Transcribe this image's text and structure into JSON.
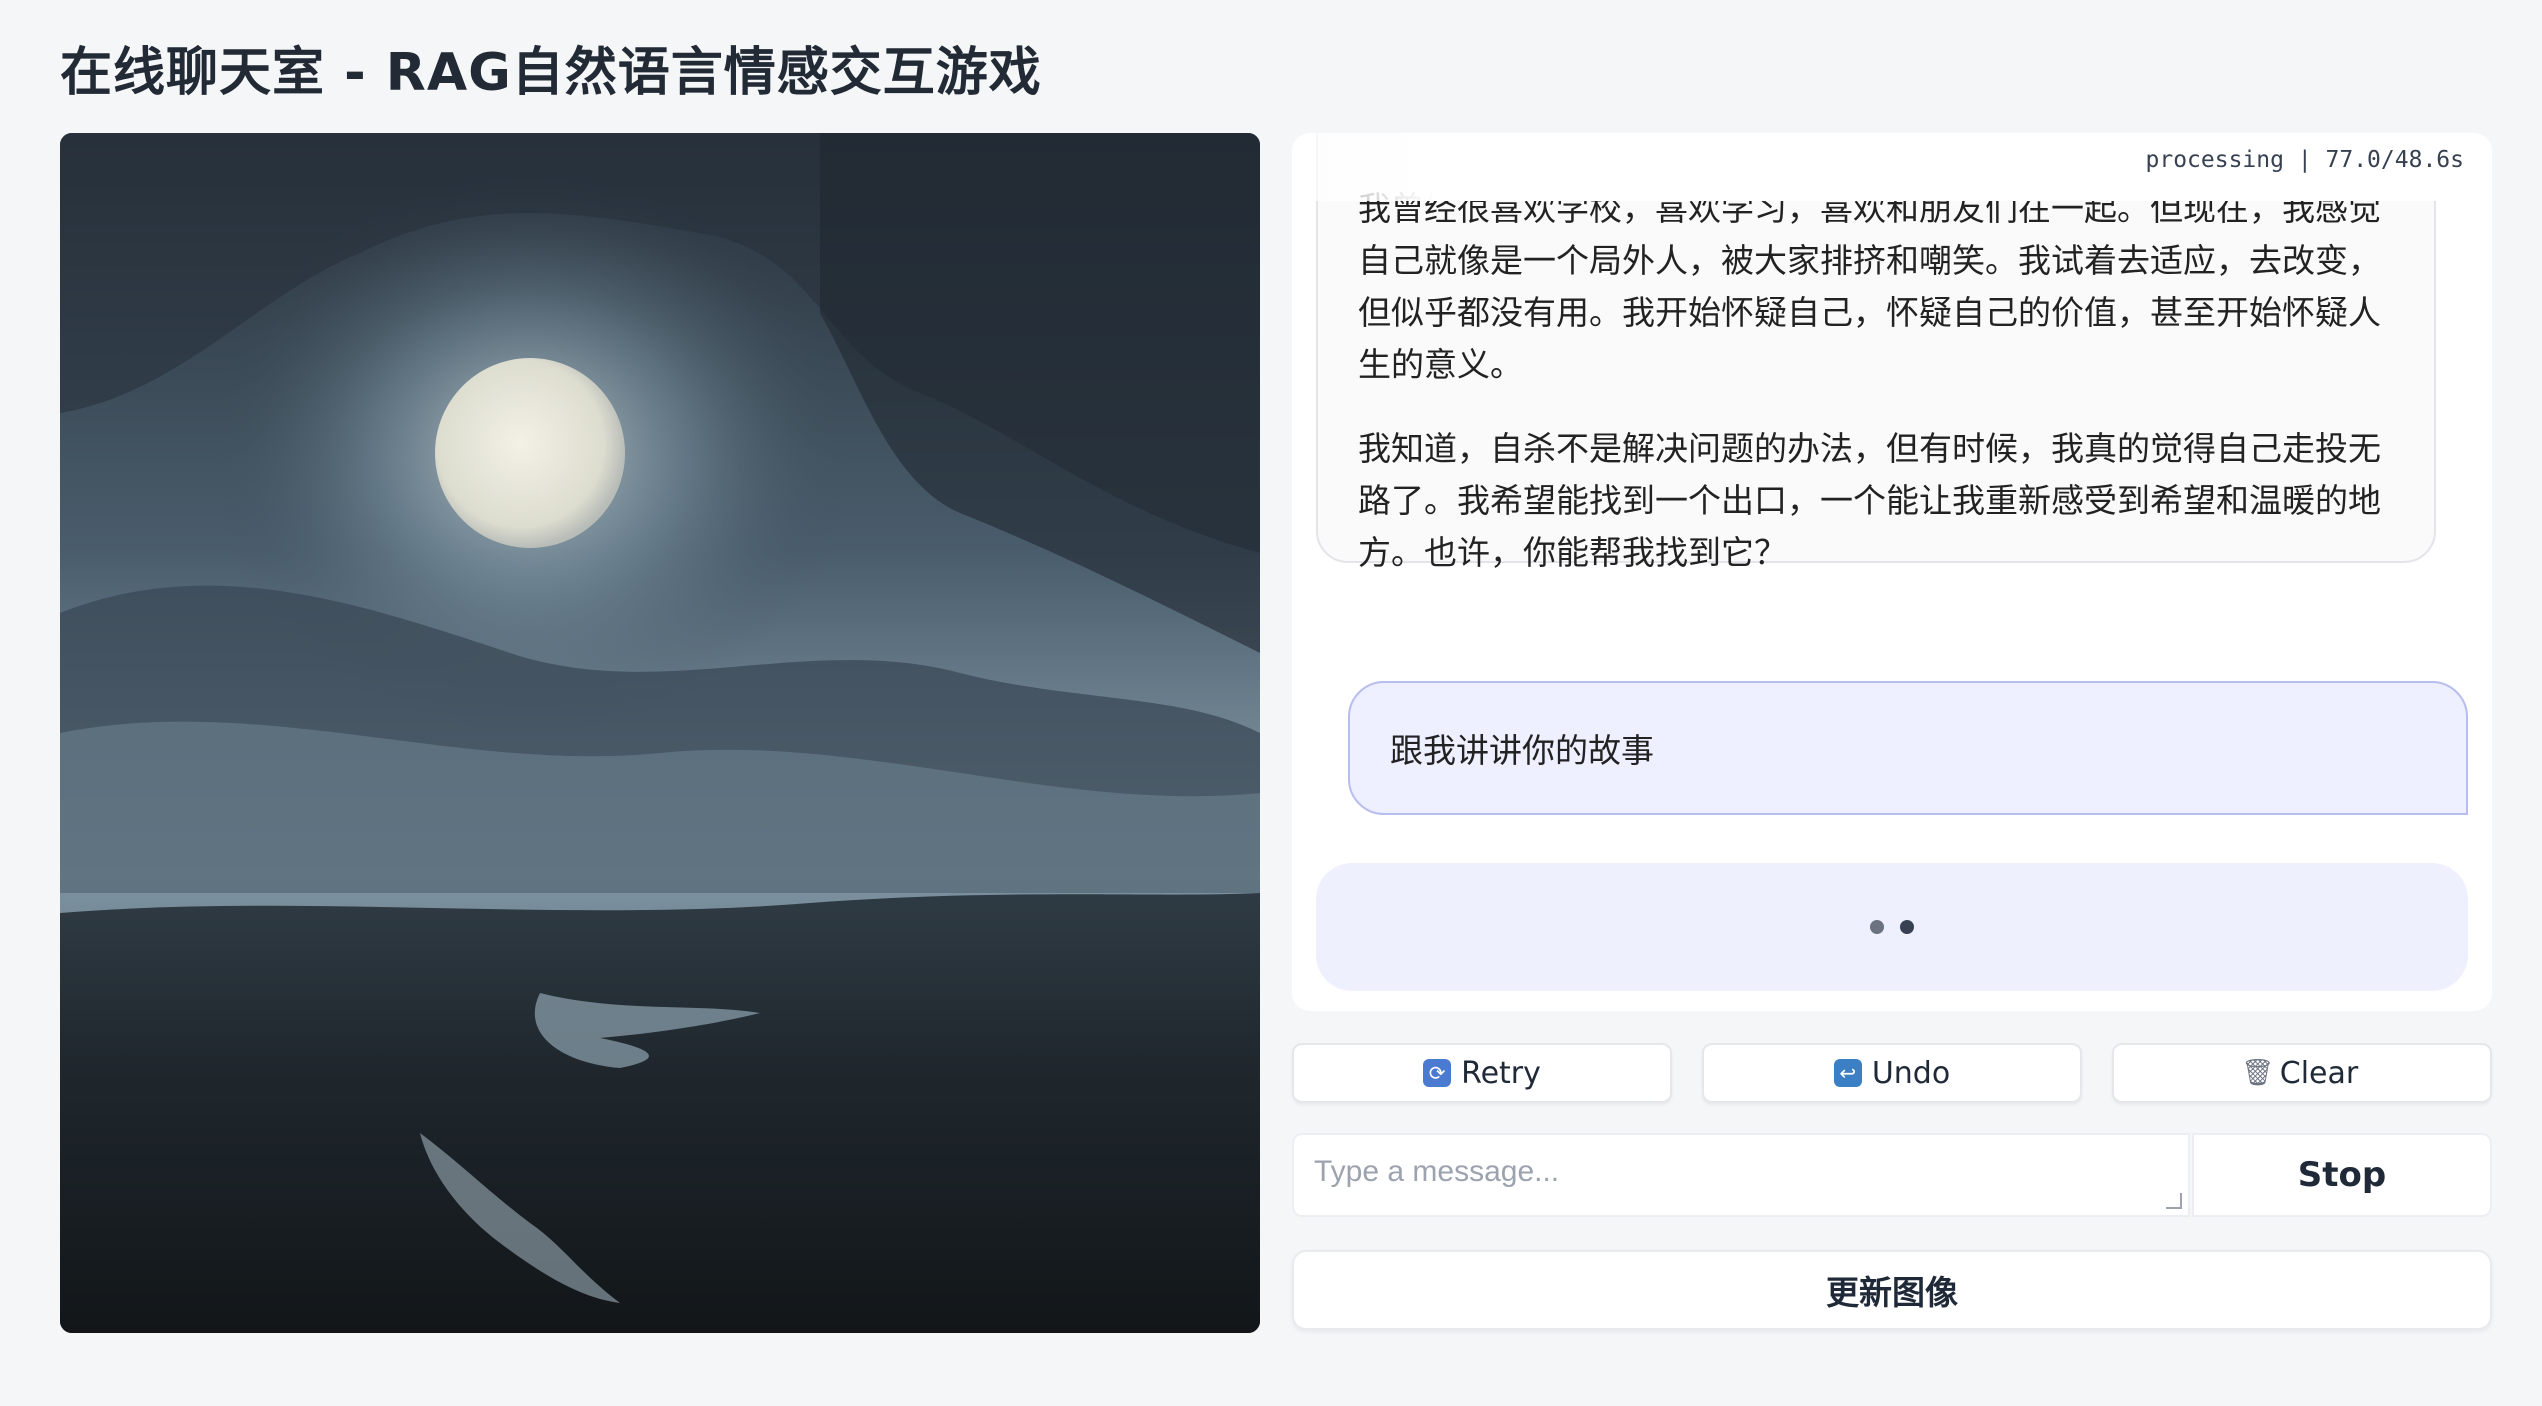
{
  "page": {
    "title": "在线聊天室 - RAG自然语言情感交互游戏"
  },
  "chat": {
    "status": "processing | 77.0/48.6s",
    "bot_message": {
      "paragraph_1": "我曾经很喜欢学校，喜欢学习，喜欢和朋友们在一起。但现在，我感觉自己就像是一个局外人，被大家排挤和嘲笑。我试着去适应，去改变，但似乎都没有用。我开始怀疑自己，怀疑自己的价值，甚至开始怀疑人生的意义。",
      "paragraph_2": "我知道，自杀不是解决问题的办法，但有时候，我真的觉得自己走投无路了。我希望能找到一个出口，一个能让我重新感受到希望和温暖的地方。也许，你能帮我找到它？"
    },
    "user_message": "跟我讲讲你的故事",
    "loading_icon": "typing-dots"
  },
  "actions": {
    "retry_label": "Retry",
    "retry_icon": "retry-icon",
    "undo_label": "Undo",
    "undo_icon": "undo-icon",
    "clear_label": "Clear",
    "clear_icon": "trash-icon"
  },
  "input": {
    "placeholder": "Type a message...",
    "value": ""
  },
  "buttons": {
    "stop_label": "Stop",
    "update_image_label": "更新图像"
  },
  "colors": {
    "accent_user_bubble": "#eef0ff",
    "accent_user_border": "#b8bdf0",
    "loading_bubble": "#eef0fd"
  }
}
